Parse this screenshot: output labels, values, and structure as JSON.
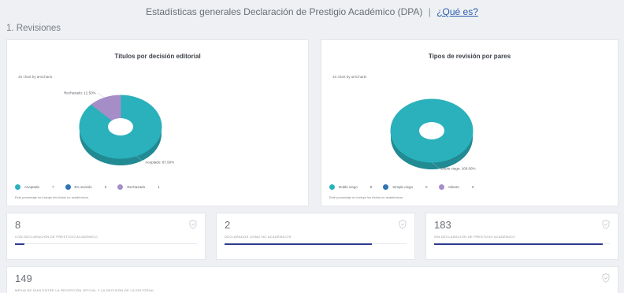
{
  "header": {
    "title": "Estadísticas generales Declaración de Prestigio Académico (DPA)",
    "separator": "|",
    "link": "¿Qué es?"
  },
  "section": {
    "title": "1. Revisiones"
  },
  "colors": {
    "teal": "#2ab1bc",
    "blue": "#2f74b4",
    "purple": "#a58ec8",
    "bar": "#2d3a8c"
  },
  "chart_data": [
    {
      "type": "pie",
      "title": "Títulos por decisión editorial",
      "credit": "JS chart by amCharts",
      "slices": [
        {
          "name": "Aceptado",
          "value": 7,
          "label": "Aceptado: 87.50%",
          "color": "#2ab1bc"
        },
        {
          "name": "En revisión",
          "value": 0,
          "label": "",
          "color": "#2f74b4"
        },
        {
          "name": "Rechazado",
          "value": 1,
          "label": "Rechazado: 12.50%",
          "color": "#a58ec8"
        }
      ],
      "legend": [
        {
          "name": "Aceptado",
          "value": "7",
          "color": "#2ab1bc"
        },
        {
          "name": "En revisión",
          "value": "0",
          "color": "#2f74b4"
        },
        {
          "name": "Rechazado",
          "value": "1",
          "color": "#a58ec8"
        }
      ],
      "note": "Este porcentaje no incluye los títulos no académicos."
    },
    {
      "type": "pie",
      "title": "Tipos de revisión por pares",
      "credit": "JS chart by amCharts",
      "slices": [
        {
          "name": "Doble ciego",
          "value": 8,
          "label": "Doble ciego: 100.00%",
          "color": "#2ab1bc"
        },
        {
          "name": "Simple ciego",
          "value": 0,
          "label": "",
          "color": "#2f74b4"
        },
        {
          "name": "Abierto",
          "value": 0,
          "label": "",
          "color": "#a58ec8"
        }
      ],
      "legend": [
        {
          "name": "Doble ciego",
          "value": "8",
          "color": "#2ab1bc"
        },
        {
          "name": "Simple ciego",
          "value": "0",
          "color": "#2f74b4"
        },
        {
          "name": "Abierto",
          "value": "0",
          "color": "#a58ec8"
        }
      ],
      "note": "Este porcentaje no incluye los títulos no académicos."
    }
  ],
  "stats": [
    {
      "value": "8",
      "label": "CON DECLARACIÓN DE PRESTIGIO ACADÉMICO",
      "progress": 0.05,
      "icon": "seal-icon"
    },
    {
      "value": "2",
      "label": "DECLARADOS COMO NO ACADÉMICOS",
      "progress": 0.81,
      "icon": "seal-icon"
    },
    {
      "value": "183",
      "label": "SIN DECLARACIÓN DE PRESTIGIO ACADÉMICO",
      "progress": 0.96,
      "icon": "seal-icon"
    },
    {
      "value": "149",
      "label": "MEDIA DE DÍAS ENTRE LA RECEPCIÓN OFICIAL Y LA DECISIÓN DE LA EDITORIAL",
      "icon": "seal-icon"
    }
  ]
}
